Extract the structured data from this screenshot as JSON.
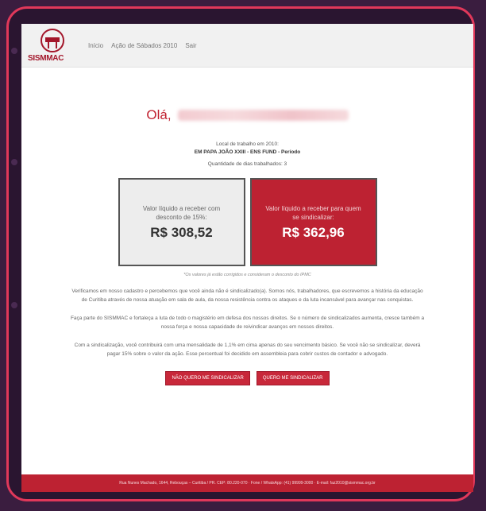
{
  "header": {
    "logo_text": "SISMMAC",
    "nav": [
      "Início",
      "Ação de Sábados 2010",
      "Sair"
    ]
  },
  "greeting": {
    "prefix": "Olá,"
  },
  "workplace": {
    "label": "Local de trabalho em 2010:",
    "value": "EM PAPA JOÃO XXIII - ENS FUND - Período",
    "days": "Quantidade de dias trabalhados: 3"
  },
  "cards": {
    "with_discount": {
      "label": "Valor líquido a receber com desconto de 15%:",
      "value": "R$ 308,52"
    },
    "unionized": {
      "label": "Valor líquido a receber para quem se sindicalizar:",
      "value": "R$ 362,96"
    }
  },
  "note": "*Os valores já estão corrigidos e consideram o desconto do IPMC",
  "paragraphs": [
    "Verificamos em nosso cadastro e percebemos que você ainda não é sindicalizado(a). Somos nós, trabalhadores, que escrevemos a história da educação de Curitiba através de nossa atuação em sala de aula, da nossa resistência contra os ataques e da luta incansável para avançar nas conquistas.",
    "Faça parte do SISMMAC e fortaleça a luta de todo o magistério em defesa dos nossos direitos. Se o número de sindicalizados aumenta, cresce também a nossa força e nossa capacidade de reivindicar avanços em nossos direitos.",
    "Com a sindicalização, você contribuirá com uma mensalidade de 1,1% em cima apenas do seu vencimento básico. Se você não se sindicalizar, deverá pagar 15% sobre o valor da ação. Esse percentual foi decidido em assembleia para cobrir custos de contador e advogado."
  ],
  "buttons": {
    "decline": "NÃO QUERO ME SINDICALIZAR",
    "accept": "QUERO ME SINDICALIZAR"
  },
  "footer": "Rua Nunes Machado, 1644, Rebouças – Curitiba / PR. CEP: 80.220-070 · Fone / WhatsApp: (41) 99999-3000 · E-mail: faz2010@sismmac.org.br",
  "colors": {
    "accent": "#bd2232",
    "frame": "#e0385a"
  }
}
